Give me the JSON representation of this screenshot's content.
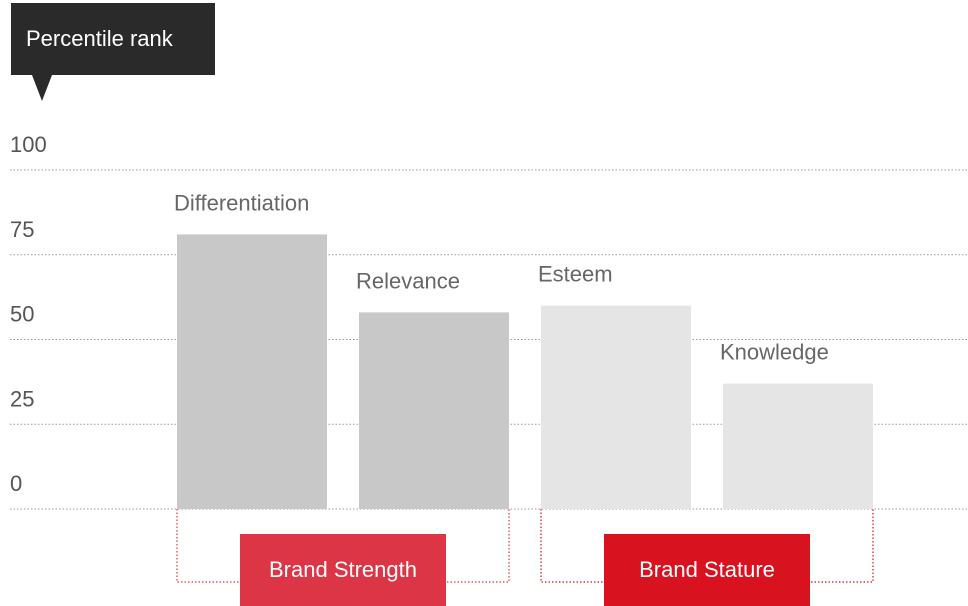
{
  "chart_data": {
    "type": "bar",
    "ylabel": "Percentile rank",
    "ylim": [
      0,
      100
    ],
    "yticks": [
      0,
      25,
      50,
      75,
      100
    ],
    "grid": true,
    "categories": [
      "Differentiation",
      "Relevance",
      "Esteem",
      "Knowledge"
    ],
    "values": [
      81,
      58,
      60,
      37
    ],
    "bar_colors": [
      "#c8c8c8",
      "#c8c8c8",
      "#e5e5e5",
      "#e5e5e5"
    ],
    "groups": [
      {
        "label": "Brand Strength",
        "members": [
          "Differentiation",
          "Relevance"
        ],
        "color": "#dc3545"
      },
      {
        "label": "Brand Stature",
        "members": [
          "Esteem",
          "Knowledge"
        ],
        "color": "#d9121f"
      }
    ]
  }
}
